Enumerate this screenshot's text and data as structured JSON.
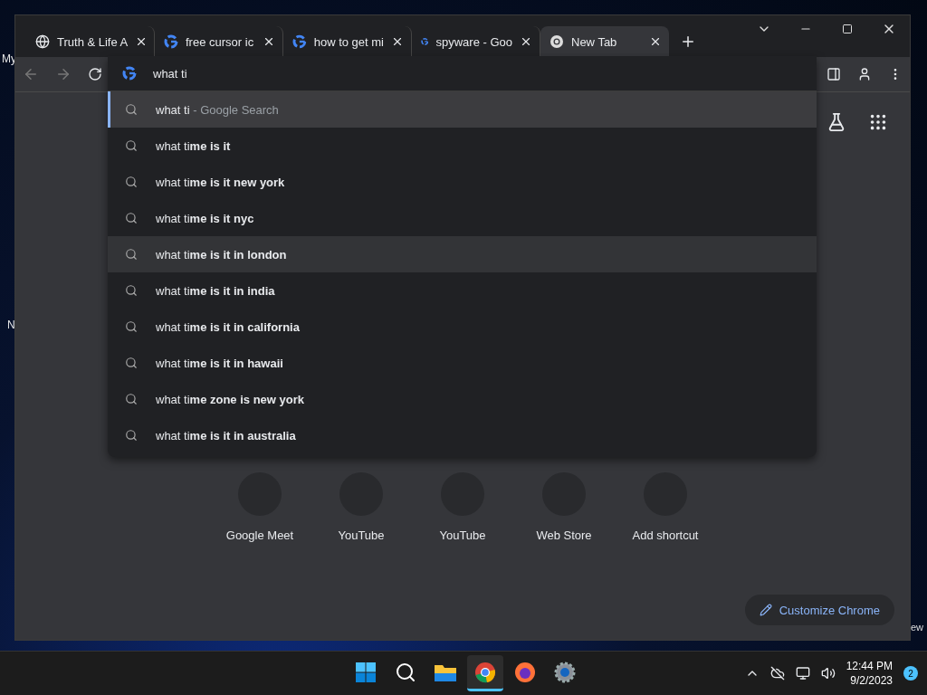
{
  "desktop": {
    "icon_labels": [
      "My",
      "N"
    ],
    "watermark": [
      "ew"
    ]
  },
  "tabs": [
    {
      "title": "Truth & Life A",
      "kind": "web",
      "selected": false
    },
    {
      "title": "free cursor ic",
      "kind": "search",
      "selected": false
    },
    {
      "title": "how to get mi",
      "kind": "search",
      "selected": false
    },
    {
      "title": "spyware - Goo",
      "kind": "search",
      "selected": false
    },
    {
      "title": "New Tab",
      "kind": "newtab",
      "selected": true
    }
  ],
  "omnibox": {
    "value": "what ti"
  },
  "suggestions": [
    {
      "text": "what ti",
      "hint": " - Google Search",
      "selected": true,
      "hovered": false
    },
    {
      "text": "what ti**me is it**",
      "selected": false,
      "hovered": false
    },
    {
      "text": "what ti**me is it new york**",
      "selected": false,
      "hovered": false
    },
    {
      "text": "what ti**me is it nyc**",
      "selected": false,
      "hovered": false
    },
    {
      "text": "what ti**me is it in london**",
      "selected": false,
      "hovered": true
    },
    {
      "text": "what ti**me is it in india**",
      "selected": false,
      "hovered": false
    },
    {
      "text": "what ti**me is it in california**",
      "selected": false,
      "hovered": false
    },
    {
      "text": "what ti**me is it in hawaii**",
      "selected": false,
      "hovered": false
    },
    {
      "text": "what ti**me zone is new york**",
      "selected": false,
      "hovered": false
    },
    {
      "text": "what ti**me is it in australia**",
      "selected": false,
      "hovered": false
    }
  ],
  "shortcuts": [
    "Google Meet",
    "YouTube",
    "YouTube",
    "Web Store",
    "Add shortcut"
  ],
  "customize_button": "Customize Chrome",
  "taskbar": {
    "apps": [
      {
        "kind": "start",
        "active": false
      },
      {
        "kind": "search",
        "active": false
      },
      {
        "kind": "folder",
        "active": false
      },
      {
        "kind": "chrome",
        "active": true
      },
      {
        "kind": "firefox",
        "active": false
      },
      {
        "kind": "settings",
        "active": false
      }
    ],
    "time": "12:44 PM",
    "date": "9/2/2023",
    "notifications": "2"
  }
}
